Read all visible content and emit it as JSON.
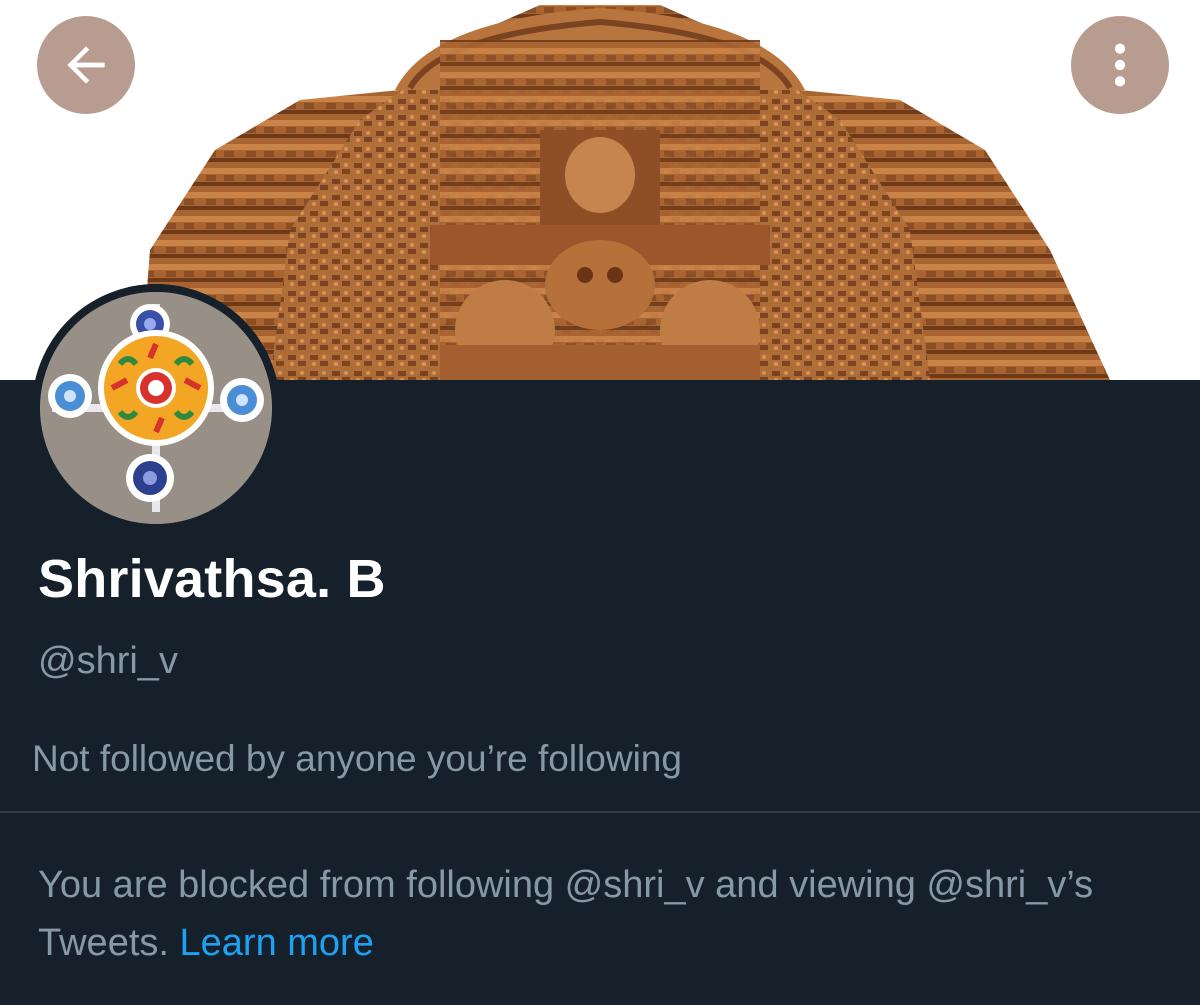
{
  "header": {
    "back_icon": "arrow-left-icon",
    "more_icon": "more-vertical-icon",
    "button_color": "#b89c8f"
  },
  "profile": {
    "display_name": "Shrivathsa. B",
    "handle": "@shri_v",
    "followed_by_text": "Not followed by anyone you’re following"
  },
  "blocked_notice": {
    "text": "You are blocked from following @shri_v and viewing @shri_v’s Tweets.",
    "link_label": "Learn more",
    "link_color": "#1da1f2"
  },
  "theme": {
    "background": "#15202b",
    "primary_text": "#ffffff",
    "secondary_text": "#8899a6"
  }
}
